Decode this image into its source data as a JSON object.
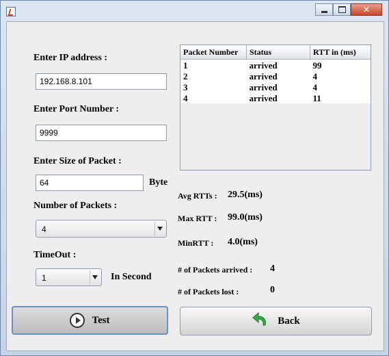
{
  "form": {
    "ip_label": "Enter IP address :",
    "ip_value": "192.168.8.101",
    "port_label": "Enter Port Number :",
    "port_value": "9999",
    "size_label": "Enter Size of Packet :",
    "size_value": "64",
    "size_unit": "Byte",
    "packets_label": "Number of Packets :",
    "packets_value": "4",
    "timeout_label": "TimeOut :",
    "timeout_value": "1",
    "timeout_unit": "In Second"
  },
  "table": {
    "columns": [
      "Packet Number",
      "Status",
      "RTT in (ms)"
    ],
    "rows": [
      [
        "1",
        "arrived",
        "99"
      ],
      [
        "2",
        "arrived",
        "4"
      ],
      [
        "3",
        "arrived",
        "4"
      ],
      [
        "4",
        "arrived",
        "11"
      ]
    ]
  },
  "stats": {
    "avg_label": "Avg RTTs :",
    "avg_value": "29.5(ms)",
    "max_label": "Max RTT :",
    "max_value": "99.0(ms)",
    "min_label": "MinRTT :",
    "min_value": "4.0(ms)",
    "arrived_label": "# of Packets arrived :",
    "arrived_value": "4",
    "lost_label": "# of Packets lost :",
    "lost_value": "0"
  },
  "buttons": {
    "test_label": "Test",
    "back_label": "Back"
  },
  "icons": {
    "app": "java-cup-icon",
    "test": "play-icon",
    "back": "back-arrow-icon"
  },
  "colors": {
    "back_arrow": "#3aa845",
    "close_button": "#c6452b"
  }
}
